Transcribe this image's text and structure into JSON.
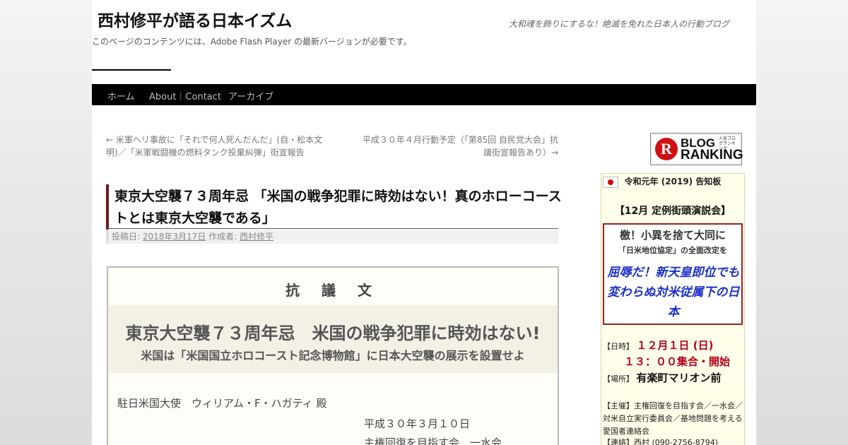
{
  "header": {
    "site_title": "西村修平が語る日本イズム",
    "site_description": "大和魂を飾りにするな！絶滅を免れた日本人の行動ブログ",
    "flash_message": "このページのコンテンツには、Adobe Flash Player の最新バージョンが必要です。"
  },
  "nav": {
    "items": [
      {
        "label": "ホーム"
      },
      {
        "label": "About｜Contact"
      },
      {
        "label": "アーカイブ"
      }
    ]
  },
  "post_navigation": {
    "previous": "← 米軍ヘリ事故に「それで何人死んだんだ」(自・松本文明)／「米軍戦闘機の燃料タンク投棄糾弾」街宣報告",
    "next": "平成３０年４月行動予定（「第85回 自民党大会」抗議街宣報告あり）→"
  },
  "post": {
    "title": "東京大空襲７３周年忌 「米国の戦争犯罪に時効はない！真のホローコーストとは東京大空襲である」",
    "meta_posted_label": "投稿日:",
    "meta_date": "2018年3月17日",
    "meta_author_label": "作成者:",
    "meta_author": "西村修平"
  },
  "protest": {
    "heading": "抗 議 文",
    "title": "東京大空襲７３周年忌　米国の戦争犯罪に時効はない!",
    "subtitle": "米国は「米国国立ホロコースト記念博物館」に日本大空襲の展示を設置せよ",
    "addressee": "駐日米国大使　ウィリアム・F・ハガティ 殿",
    "date": "平成３０年３月１０日",
    "org": "主権回復を目指す会　一水会"
  },
  "sidebar": {
    "blog_ranking": {
      "letter": "R",
      "word1": "BLOG",
      "word2": "RANKING",
      "small": "人気ブログランキング"
    },
    "notice": {
      "title": "令和元年 (2019) 告知板",
      "event": "【12月 定例街頭演説会】",
      "inner_line1": "檄！小異を捨て大同に",
      "inner_line2": "「日米地位協定」の全面改定を",
      "inner_line3": "屈辱だ！新天皇即位でも変わらぬ対米従属下の日本",
      "date_label": "【日時】",
      "date_value": "１２月１日 (日)",
      "time_value": "１３：００集合・開始",
      "place_label": "【場所】",
      "place_value": "有楽町マリオン前",
      "host": "【主催】主権回復を目指す会／一水会／対米自立実行委員会／基地問題を考える愛国者連絡会",
      "contact": "【連絡】西村 (090-2756-8794)"
    }
  },
  "colors": {
    "nav_bg": "#000000",
    "title_accent": "#6b1a1a",
    "notice_bg": "#fffee8",
    "red_text": "#b3001b",
    "blue_text": "#1a2fc8"
  }
}
